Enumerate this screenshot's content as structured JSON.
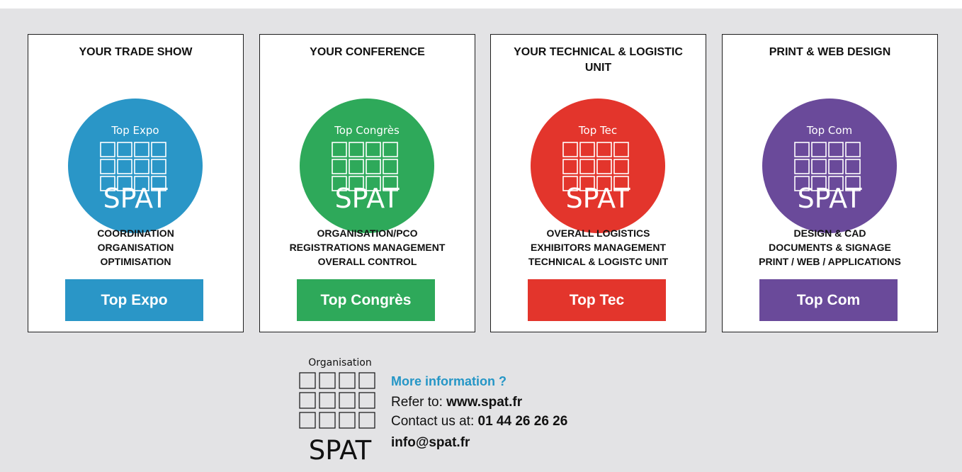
{
  "cards": [
    {
      "title": "YOUR TRADE SHOW",
      "logo_name": "Top Expo",
      "logo_brand": "SPAT",
      "color": "#2a96c7",
      "features": [
        "COORDINATION",
        "ORGANISATION",
        "OPTIMISATION"
      ],
      "button_label": "Top Expo"
    },
    {
      "title": "YOUR CONFERENCE",
      "logo_name": "Top Congrès",
      "logo_brand": "SPAT",
      "color": "#2ea95a",
      "features": [
        "ORGANISATION/PCO",
        "REGISTRATIONS MANAGEMENT",
        "OVERALL CONTROL"
      ],
      "button_label": "Top Congrès"
    },
    {
      "title": "YOUR TECHNICAL & LOGISTIC UNIT",
      "logo_name": "Top Tec",
      "logo_brand": "SPAT",
      "color": "#e3352c",
      "features": [
        "OVERALL LOGISTICS",
        "EXHIBITORS MANAGEMENT",
        "TECHNICAL & LOGISTC UNIT"
      ],
      "button_label": "Top Tec"
    },
    {
      "title": "PRINT & WEB DESIGN",
      "logo_name": "Top Com",
      "logo_brand": "SPAT",
      "color": "#6a4a9a",
      "features": [
        "DESIGN & CAD",
        "DOCUMENTS & SIGNAGE",
        "PRINT / WEB / APPLICATIONS"
      ],
      "button_label": "Top Com"
    }
  ],
  "footer": {
    "logo_caption": "Organisation",
    "logo_brand": "SPAT",
    "more_info_title": "More information ?",
    "refer_label": "Refer to: ",
    "website": "www.spat.fr",
    "contact_label": "Contact us at: ",
    "phone": "01 44 26 26 26",
    "email": "info@spat.fr"
  }
}
